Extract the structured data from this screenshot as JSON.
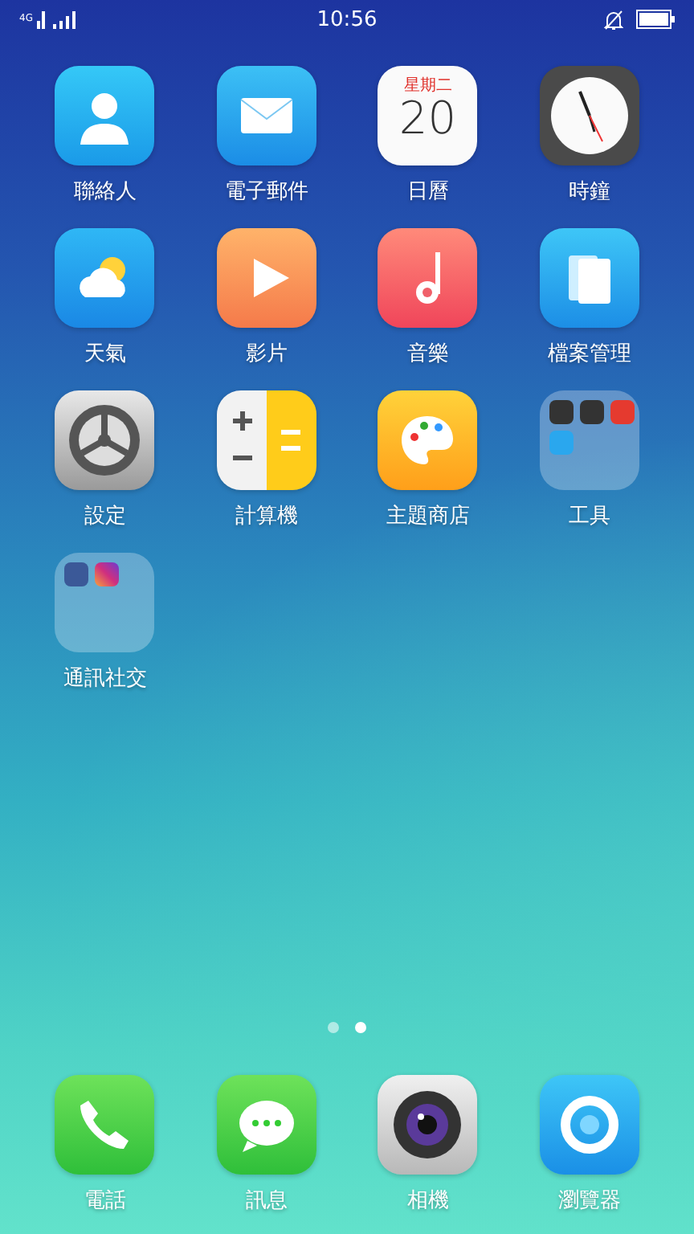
{
  "status_bar": {
    "network": "4G",
    "time": "10:56"
  },
  "apps": [
    {
      "kind": "contacts",
      "label": "聯絡人"
    },
    {
      "kind": "mail",
      "label": "電子郵件"
    },
    {
      "kind": "calendar",
      "label": "日曆",
      "weekday": "星期二",
      "day": "20"
    },
    {
      "kind": "clock",
      "label": "時鐘"
    },
    {
      "kind": "weather",
      "label": "天氣"
    },
    {
      "kind": "video",
      "label": "影片"
    },
    {
      "kind": "music",
      "label": "音樂"
    },
    {
      "kind": "files",
      "label": "檔案管理"
    },
    {
      "kind": "settings",
      "label": "設定"
    },
    {
      "kind": "calculator",
      "label": "計算機"
    },
    {
      "kind": "themes",
      "label": "主題商店"
    },
    {
      "kind": "folder",
      "label": "工具",
      "items": [
        {
          "kind": "recorder"
        },
        {
          "kind": "compass"
        },
        {
          "kind": "office"
        },
        {
          "kind": "notes"
        }
      ]
    },
    {
      "kind": "folder",
      "label": "通訊社交",
      "items": [
        {
          "kind": "facebook"
        },
        {
          "kind": "instagram"
        }
      ]
    }
  ],
  "pages": [
    {
      "selected": false
    },
    {
      "selected": true
    }
  ],
  "dock": [
    {
      "kind": "phone",
      "label": "電話"
    },
    {
      "kind": "messages",
      "label": "訊息"
    },
    {
      "kind": "camera",
      "label": "相機"
    },
    {
      "kind": "browser",
      "label": "瀏覽器"
    }
  ]
}
